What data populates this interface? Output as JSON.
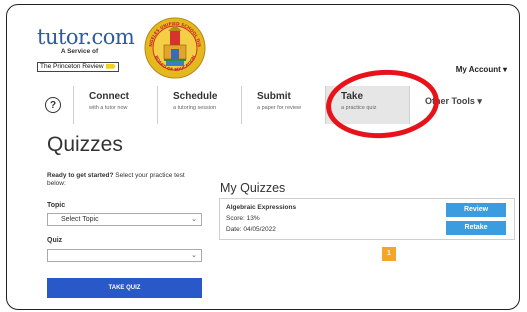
{
  "logo": {
    "brand": "tutor.com",
    "tagline": "A Service of",
    "partner": "The Princeton Review"
  },
  "seal": {
    "top_text": "LOS ANGELES UNIFIED SCHOOL DISTRICT",
    "bottom_text": "BOARD OF EDUCATION"
  },
  "header": {
    "account_label": "My Account ▾"
  },
  "nav": {
    "help_glyph": "?",
    "items": [
      {
        "title": "Connect",
        "subtitle": "with a tutor now"
      },
      {
        "title": "Schedule",
        "subtitle": "a tutoring session"
      },
      {
        "title": "Submit",
        "subtitle": "a paper for review"
      },
      {
        "title": "Take",
        "subtitle": "a practice quiz"
      }
    ],
    "other_tools": "Other Tools ▾",
    "active_index": 3
  },
  "page": {
    "title": "Quizzes"
  },
  "form": {
    "intro_bold": "Ready to get started?",
    "intro_rest": " Select your practice test below:",
    "topic_label": "Topic",
    "topic_value": "Select Topic",
    "quiz_label": "Quiz",
    "quiz_value": "",
    "submit_label": "TAKE QUIZ"
  },
  "my_quizzes": {
    "title": "My Quizzes",
    "items": [
      {
        "name": "Algebraic Expressions",
        "score": "Score: 13%",
        "date": "Date: 04/05/2022",
        "review_label": "Review",
        "retake_label": "Retake"
      }
    ],
    "pagination": {
      "current": "1"
    }
  },
  "colors": {
    "brand_blue": "#2d5b9c",
    "button_blue": "#2958c8",
    "action_blue": "#3b9de0",
    "page_orange": "#f5a52a",
    "highlight_red": "#e8121a",
    "seal_gold": "#e5b81e",
    "seal_red": "#d7322d"
  }
}
